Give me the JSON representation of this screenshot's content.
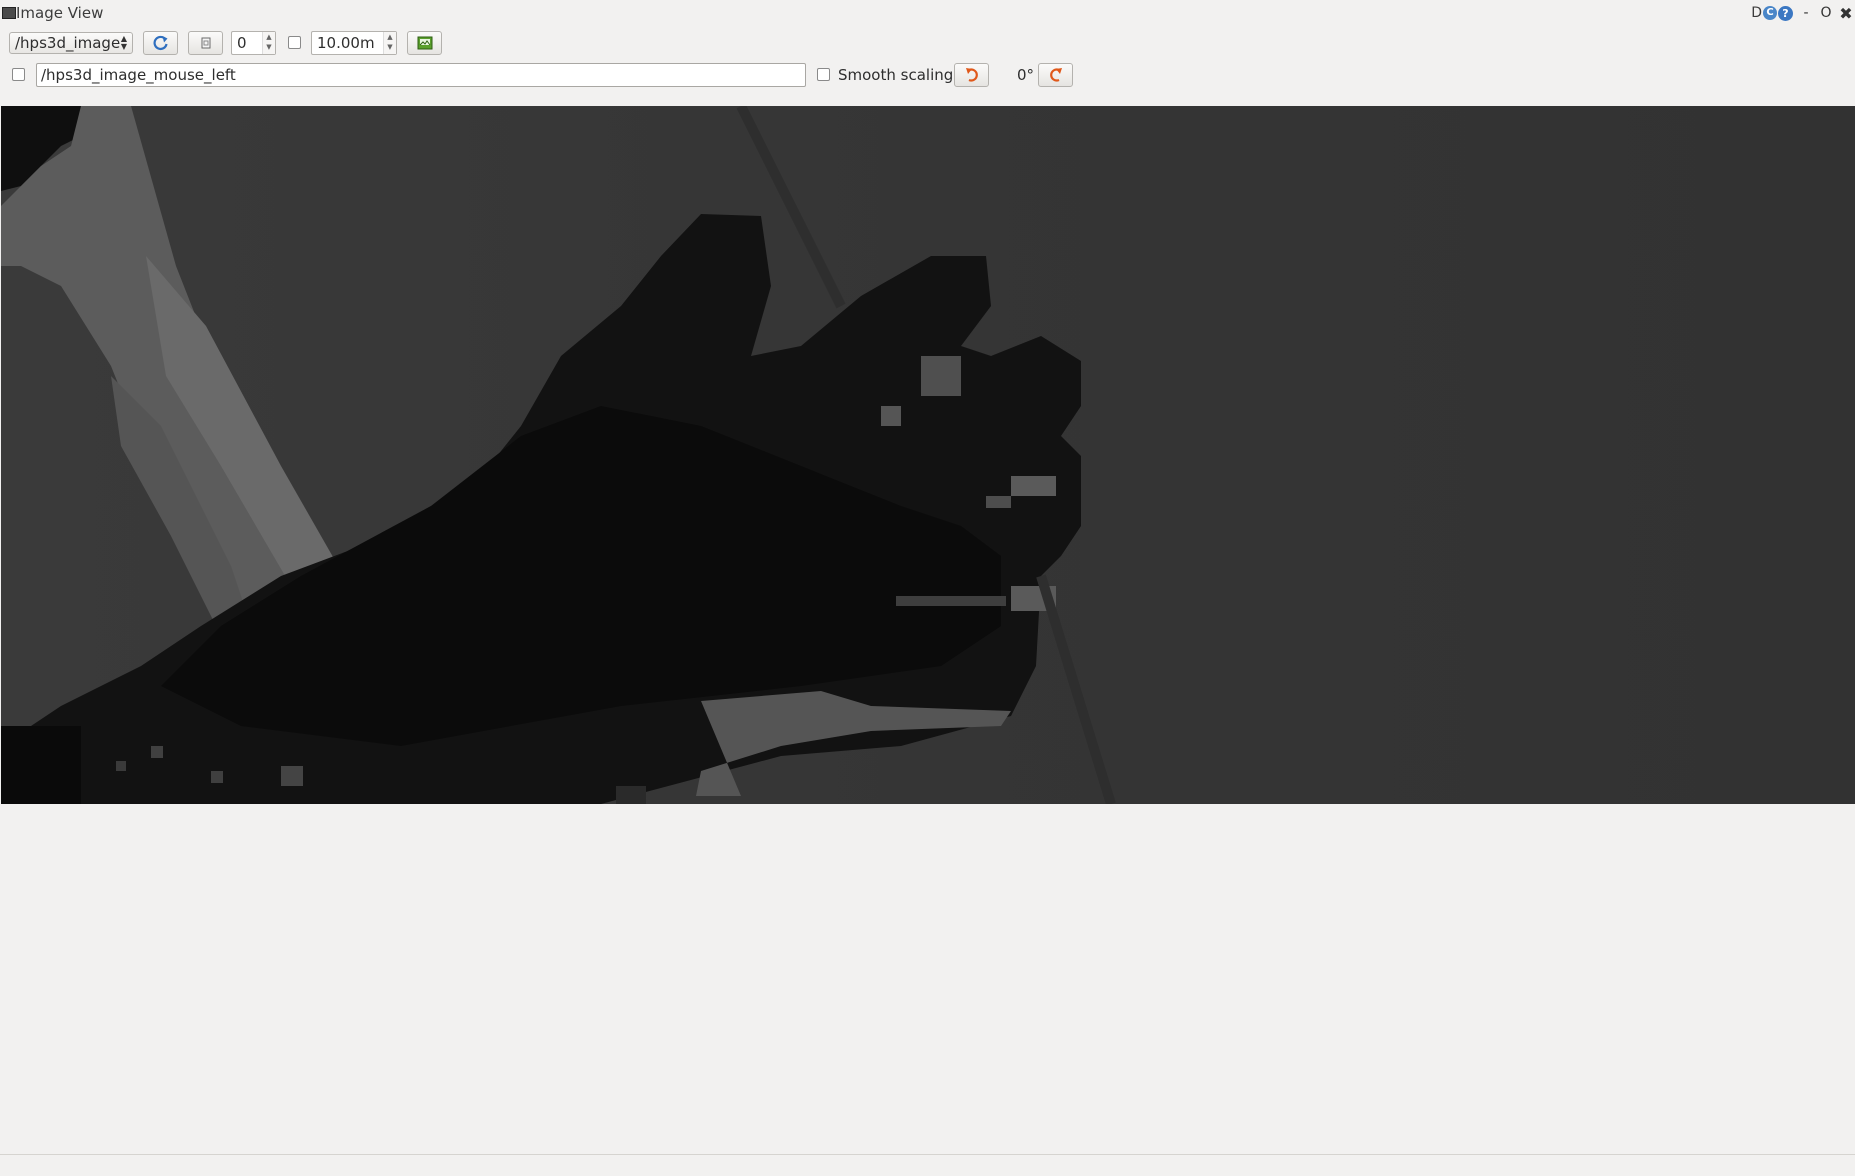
{
  "window": {
    "title": "Image View",
    "help_label": "D",
    "reload_glyph": "C",
    "help_glyph": "?",
    "minimize_glyph": "-",
    "restore_glyph": "O",
    "close_glyph": "✖"
  },
  "toolbar": {
    "topic_select": "/hps3d_image",
    "spin_value": "0",
    "max_range": "10.00m",
    "mouse_topic": "/hps3d_image_mouse_left",
    "smooth_scaling_label": "Smooth scaling",
    "rotation_label": "0°"
  },
  "icons": {
    "refresh": "refresh-icon",
    "zoom_fit": "zoom-fit-icon",
    "save": "save-image-icon",
    "rotate_left": "rotate-left-icon",
    "rotate_right": "rotate-right-icon"
  },
  "colors": {
    "accent_blue": "#4a86c8",
    "accent_orange": "#e0581a",
    "image_bg": "#343434"
  }
}
